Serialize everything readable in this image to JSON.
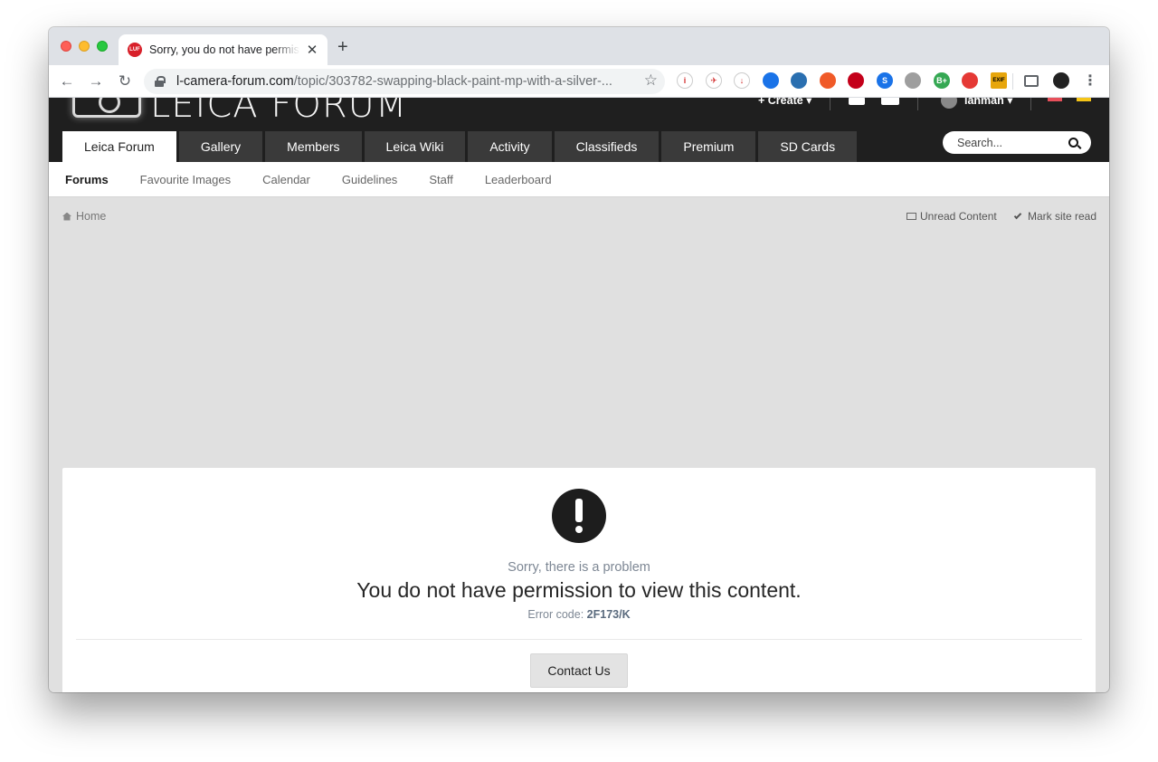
{
  "browser": {
    "tab_title": "Sorry, you do not have permission to view this content",
    "favicon_text": "LUF",
    "close_glyph": "✕",
    "new_tab_glyph": "+",
    "url_host": "l-camera-forum.com",
    "url_path": "/topic/303782-swapping-black-paint-mp-with-a-silver-...",
    "back_glyph": "←",
    "forward_glyph": "→",
    "reload_glyph": "↻",
    "star_glyph": "☆",
    "extensions": [
      {
        "name": "info-extension-icon",
        "glyph": "i",
        "color": "#ffffff"
      },
      {
        "name": "plane-extension-icon",
        "glyph": "✈",
        "color": "#ffffff"
      },
      {
        "name": "download-extension-icon",
        "glyph": "↓",
        "color": "#ffffff"
      },
      {
        "name": "compass-extension-icon",
        "glyph": "",
        "color": "#1a73e8"
      },
      {
        "name": "spy-extension-icon",
        "glyph": "",
        "color": "#2a6fb0"
      },
      {
        "name": "lighthouse-extension-icon",
        "glyph": "",
        "color": "#f05a28"
      },
      {
        "name": "ublock-extension-icon",
        "glyph": "",
        "color": "#c4001a"
      },
      {
        "name": "s-extension-icon",
        "glyph": "S",
        "color": "#1a73e8"
      },
      {
        "name": "moon-extension-icon",
        "glyph": "",
        "color": "#9e9e9e"
      },
      {
        "name": "b-plus-extension-icon",
        "glyph": "B+",
        "color": "#35a853"
      },
      {
        "name": "color-pen-extension-icon",
        "glyph": "",
        "color": "#e53935"
      },
      {
        "name": "exif-extension-icon",
        "glyph": "EXIF",
        "color": "#e7a60c"
      }
    ],
    "menu_glyph": "⋮"
  },
  "site": {
    "logo_text": "LEICA FORUM",
    "create_label": "+ Create ▾",
    "user_label": "ianman ▾",
    "nav_tabs": [
      "Leica Forum",
      "Gallery",
      "Members",
      "Leica Wiki",
      "Activity",
      "Classifieds",
      "Premium",
      "SD Cards"
    ],
    "search_placeholder": "Search...",
    "subnav": [
      "Forums",
      "Favourite Images",
      "Calendar",
      "Guidelines",
      "Staff",
      "Leaderboard"
    ],
    "breadcrumb_home": "Home",
    "unread_content": "Unread Content",
    "mark_site_read": "Mark site read"
  },
  "error": {
    "subtitle": "Sorry, there is a problem",
    "title": "You do not have permission to view this content.",
    "code_label": "Error code: ",
    "code_value": "2F173/K",
    "contact_button": "Contact Us"
  }
}
